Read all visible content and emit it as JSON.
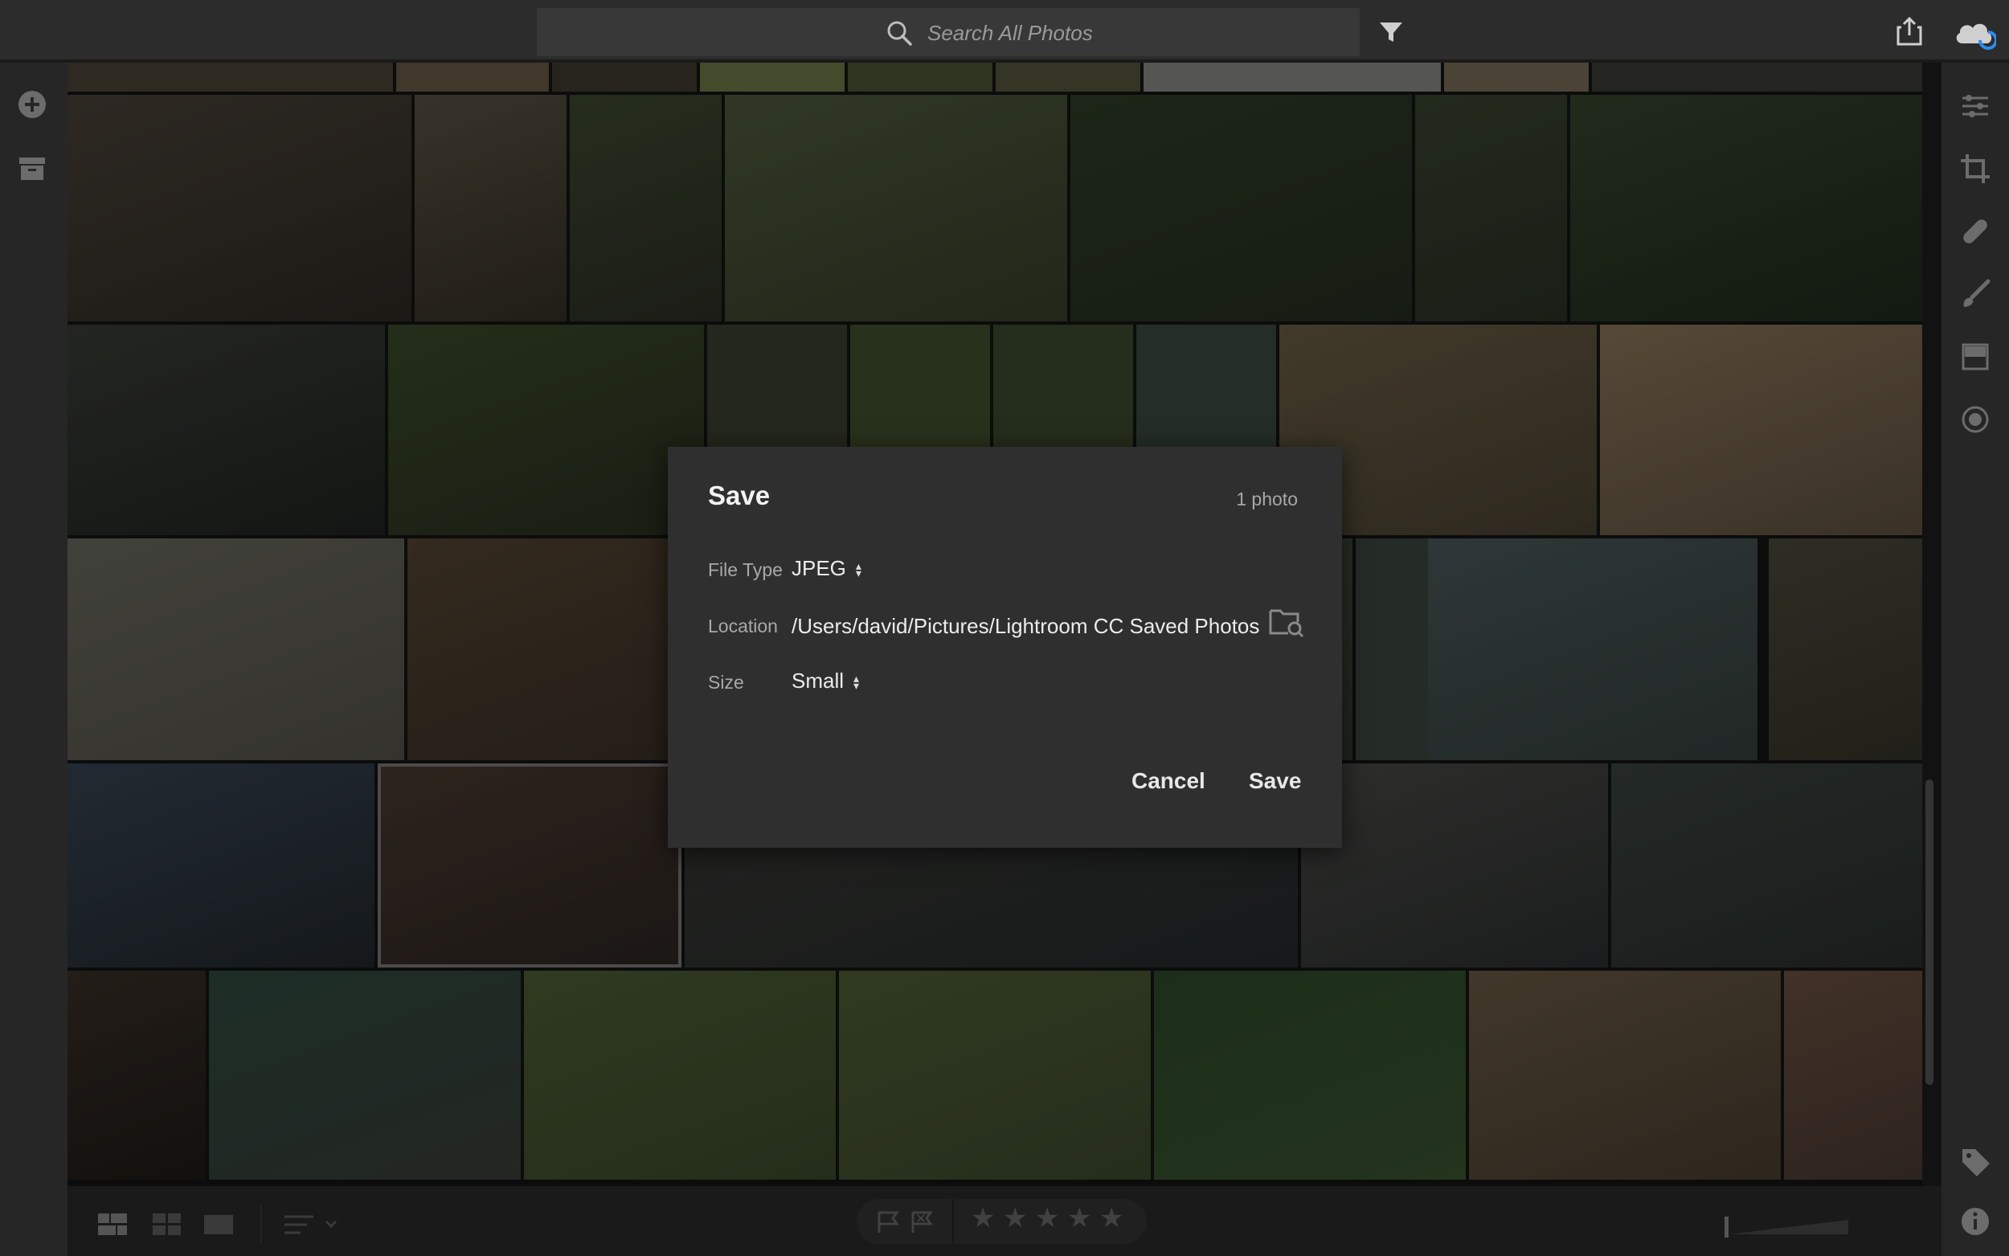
{
  "search": {
    "placeholder": "Search All Photos"
  },
  "dialog": {
    "title": "Save",
    "count": "1 photo",
    "file_type_label": "File Type",
    "file_type_value": "JPEG",
    "location_label": "Location",
    "location_value": "/Users/david/Pictures/Lightroom CC Saved Photos",
    "size_label": "Size",
    "size_value": "Small",
    "cancel_label": "Cancel",
    "save_label": "Save"
  },
  "icons": {
    "top": [
      "search-icon",
      "filter-icon",
      "share-icon",
      "cloud-sync-icon"
    ],
    "left": [
      "add-icon",
      "archive-icon"
    ],
    "right": [
      "sliders-icon",
      "crop-icon",
      "healing-icon",
      "brush-icon",
      "linear-gradient-icon",
      "radial-gradient-icon",
      "tag-icon",
      "info-icon"
    ],
    "bottom": [
      "photo-grid-icon",
      "square-grid-icon",
      "detail-view-icon",
      "sort-icon",
      "flag-pick-icon",
      "flag-reject-icon",
      "star-icon"
    ]
  },
  "colors": {
    "background": "#1e1e1e",
    "dialog": "#2f2f2f",
    "accent": "#2d8ceb"
  }
}
